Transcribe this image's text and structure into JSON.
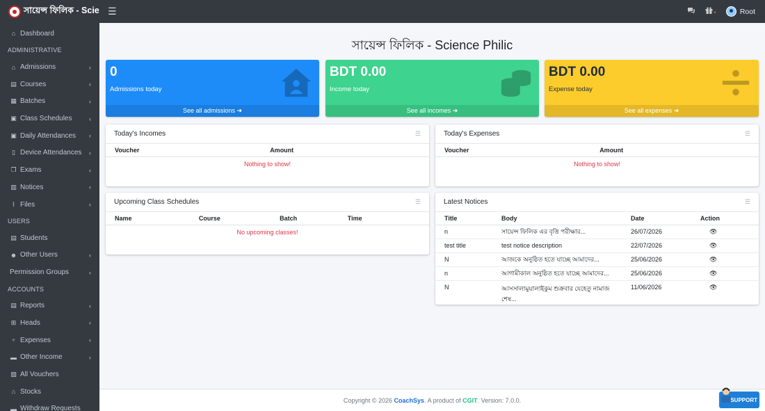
{
  "topbar": {
    "brand": "সায়েন্স ফিলিক - Science Philic",
    "user": "Root"
  },
  "sidebar": {
    "dashboard": "Dashboard",
    "sections": [
      {
        "header": "ADMINISTRATIVE",
        "items": [
          {
            "label": "Admissions",
            "icon": "home-icon"
          },
          {
            "label": "Courses",
            "icon": "book-icon"
          },
          {
            "label": "Batches",
            "icon": "grid-icon"
          },
          {
            "label": "Class Schedules",
            "icon": "calendar-icon"
          },
          {
            "label": "Daily Attendances",
            "icon": "calendar-check-icon"
          },
          {
            "label": "Device Attendances",
            "icon": "mobile-icon"
          },
          {
            "label": "Exams",
            "icon": "copy-icon"
          },
          {
            "label": "Notices",
            "icon": "clipboard-icon"
          },
          {
            "label": "Files",
            "icon": "paperclip-icon"
          }
        ]
      },
      {
        "header": "USERS",
        "items": [
          {
            "label": "Students",
            "icon": "id-card-icon"
          },
          {
            "label": "Other Users",
            "icon": "users-icon"
          },
          {
            "label": "Permission Groups",
            "icon": ""
          }
        ]
      },
      {
        "header": "ACCOUNTS",
        "items": [
          {
            "label": "Reports",
            "icon": "file-icon"
          },
          {
            "label": "Heads",
            "icon": "sitemap-icon"
          },
          {
            "label": "Expenses",
            "icon": "divide-icon"
          },
          {
            "label": "Other Income",
            "icon": "money-icon"
          },
          {
            "label": "All Vouchers",
            "icon": "receipt-icon"
          },
          {
            "label": "Stocks",
            "icon": "warehouse-icon"
          },
          {
            "label": "Withdraw Requests",
            "icon": "money-bill-icon"
          }
        ]
      }
    ]
  },
  "main": {
    "title": "সায়েন্স ফিলিক - Science Philic",
    "stats": [
      {
        "value": "0",
        "label": "Admissions today",
        "link": "See all admissions",
        "color": "#1e8cf8"
      },
      {
        "value": "BDT 0.00",
        "label": "Income today",
        "link": "See all incomes",
        "color": "#3ed38e"
      },
      {
        "value": "BDT 0.00",
        "label": "Expense today",
        "link": "See all expenses",
        "color": "#fccc2c"
      }
    ],
    "incomes": {
      "title": "Today's Incomes",
      "columns": [
        "Voucher",
        "Amount"
      ],
      "empty": "Nothing to show!"
    },
    "expenses": {
      "title": "Today's Expenses",
      "columns": [
        "Voucher",
        "Amount"
      ],
      "empty": "Nothing to show!"
    },
    "schedules": {
      "title": "Upcoming Class Schedules",
      "columns": [
        "Name",
        "Course",
        "Batch",
        "Time"
      ],
      "empty": "No upcoming classes!"
    },
    "notices": {
      "title": "Latest Notices",
      "columns": [
        "Title",
        "Body",
        "Date",
        "Action"
      ],
      "rows": [
        {
          "title": "n",
          "body": "সায়েন্স ফিলিক এর বৃত্তি পরীক্ষার...",
          "date": "26/07/2026"
        },
        {
          "title": "test title",
          "body": "test notice description",
          "date": "22/07/2026"
        },
        {
          "title": "N",
          "body": "আজকে অনুষ্ঠিত হতে যাচ্ছে আমাদের...",
          "date": "25/06/2026"
        },
        {
          "title": "n",
          "body": "আগামীকাল অনুষ্ঠিত হতে যাচ্ছে আমাদের...",
          "date": "25/06/2026"
        },
        {
          "title": "N",
          "body": "আসসালামুয়ালাইকুম শুক্রবার যেহেতু নামাজ শেষ...",
          "date": "11/06/2026"
        }
      ]
    }
  },
  "footer": {
    "prefix": "Copyright © 2026 ",
    "brand": "CoachSys",
    "middle": ". A product of ",
    "company": "CGIT",
    "suffix": ". Version: 7.0.0."
  },
  "support": {
    "label": "SUPPORT"
  }
}
